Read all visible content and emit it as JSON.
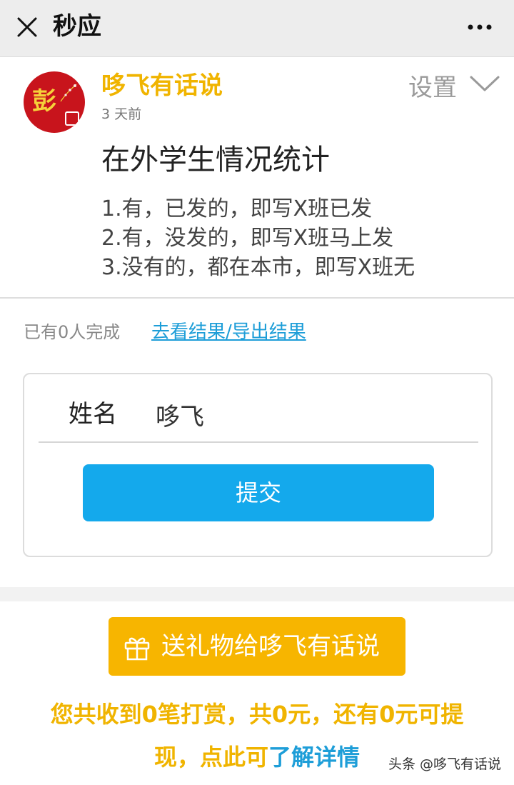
{
  "topbar": {
    "title": "秒应",
    "close_icon": "close-icon",
    "more_icon": "more-icon"
  },
  "post": {
    "avatar_char": "彭",
    "author": "哆飞有话说",
    "time": "3 天前",
    "settings_label": "设置",
    "title": "在外学生情况统计",
    "body_lines": [
      "1.有，已发的，即写X班已发",
      "2.有，没发的，即写X班马上发",
      "3.没有的，都在本市，即写X班无"
    ]
  },
  "form": {
    "done_count": "已有0人完成",
    "result_link": "去看结果/导出结果",
    "field_label": "姓名",
    "field_value": "哆飞",
    "submit_label": "提交"
  },
  "gift": {
    "button_label": "送礼物给哆飞有话说",
    "reward_prefix": "您共收到0笔打赏，共0元，还有0元可提现，点此可",
    "reward_link": "了解详情"
  },
  "watermark": "头条 @哆飞有话说",
  "colors": {
    "accent_yellow": "#f0b400",
    "button_blue": "#14a9ec",
    "link_blue": "#1e9ed8",
    "avatar_red": "#c8141c"
  }
}
